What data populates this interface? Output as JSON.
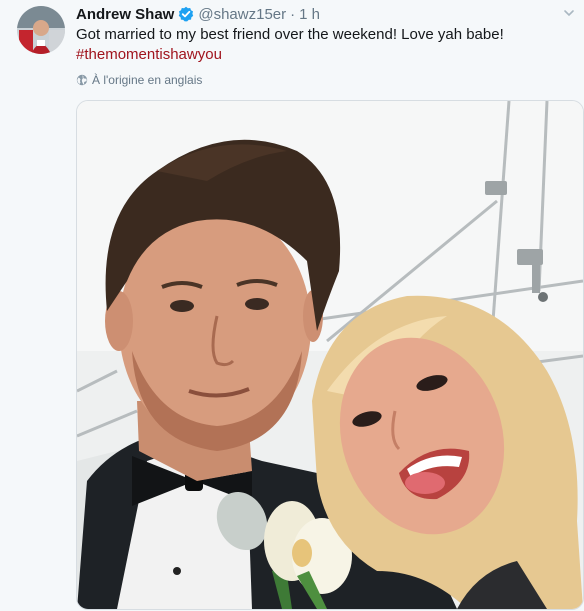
{
  "tweet": {
    "author": {
      "display_name": "Andrew Shaw",
      "handle": "@shawz15er",
      "verified": true
    },
    "separator": "·",
    "timestamp": "1 h",
    "text": "Got married to my best friend over the weekend! Love yah babe!",
    "hashtag": "#themomentishawyou",
    "translate_label": "À l'origine en anglais",
    "icons": {
      "verified": "verified-badge-icon",
      "globe": "globe-icon",
      "more": "chevron-down-icon"
    },
    "colors": {
      "accent": "#a0141e",
      "secondary_text": "#657786",
      "verified": "#1da1f2"
    }
  }
}
